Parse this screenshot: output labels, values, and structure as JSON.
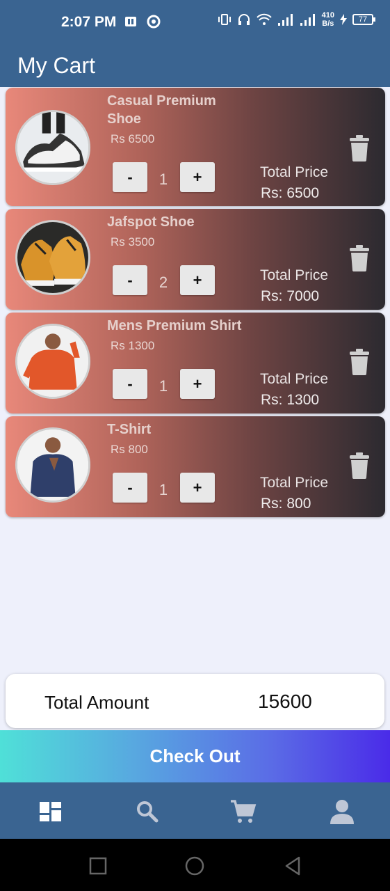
{
  "status_bar": {
    "time": "2:07 PM",
    "net_speed_top": "410",
    "net_speed_bottom": "B/s",
    "battery": "77"
  },
  "app_bar": {
    "title": "My Cart"
  },
  "cart": {
    "items": [
      {
        "name": "Casual Premium Shoe",
        "unit_price": "Rs  6500",
        "minus": "-",
        "qty": "1",
        "plus": "+",
        "total_label": "Total Price",
        "total_value": "Rs:  6500",
        "image": "sneaker-white-black"
      },
      {
        "name": "Jafspot Shoe",
        "unit_price": "Rs  3500",
        "minus": "-",
        "qty": "2",
        "plus": "+",
        "total_label": "Total Price",
        "total_value": "Rs:  7000",
        "image": "sneaker-orange"
      },
      {
        "name": "Mens Premium Shirt",
        "unit_price": "Rs  1300",
        "minus": "-",
        "qty": "1",
        "plus": "+",
        "total_label": "Total Price",
        "total_value": "Rs:  1300",
        "image": "orange-shirt-man"
      },
      {
        "name": "T-Shirt",
        "unit_price": "Rs  800",
        "minus": "-",
        "qty": "1",
        "plus": "+",
        "total_label": "Total Price",
        "total_value": "Rs:  800",
        "image": "navy-shirt-man"
      }
    ]
  },
  "summary": {
    "label": "Total Amount",
    "value": "15600"
  },
  "checkout": {
    "label": "Check Out"
  },
  "bottom_nav": {
    "items": [
      "dashboard-icon",
      "search-icon",
      "cart-icon",
      "profile-icon"
    ]
  },
  "colors": {
    "primary": "#3a6491",
    "background": "#eef0fb"
  }
}
